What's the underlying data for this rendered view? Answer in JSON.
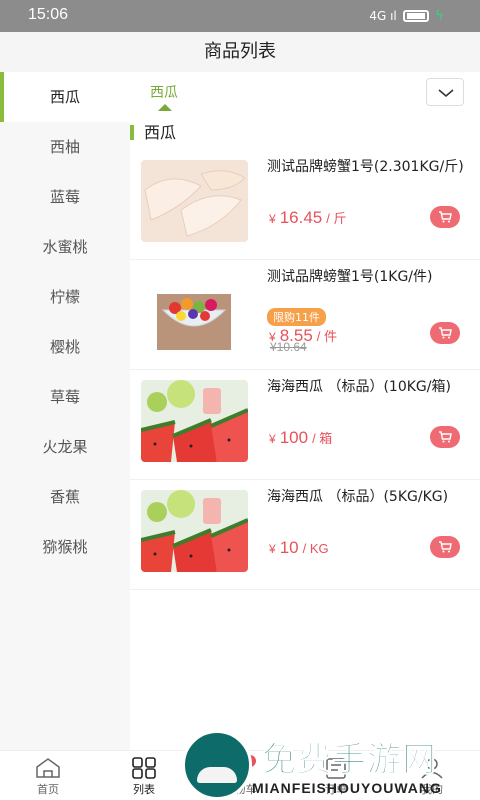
{
  "status": {
    "time": "15:06",
    "signal": "4G ıl"
  },
  "header": {
    "title": "商品列表"
  },
  "sidebar": {
    "items": [
      {
        "label": "西瓜"
      },
      {
        "label": "西柚"
      },
      {
        "label": "蓝莓"
      },
      {
        "label": "水蜜桃"
      },
      {
        "label": "柠檬"
      },
      {
        "label": "樱桃"
      },
      {
        "label": "草莓"
      },
      {
        "label": "火龙果"
      },
      {
        "label": "香蕉"
      },
      {
        "label": "猕猴桃"
      }
    ],
    "active": "西瓜"
  },
  "subtabs": {
    "active_label": "西瓜"
  },
  "section": {
    "title": "西瓜"
  },
  "products": [
    {
      "name": "测试品牌螃蟹1号(2.301KG/斤)",
      "currency": "¥",
      "price": "16.45",
      "unit": "/ 斤"
    },
    {
      "name": "测试品牌螃蟹1号(1KG/件)",
      "limit": "限购11件",
      "currency": "¥",
      "price": "8.55",
      "unit": "/ 件",
      "old_price": "¥10.64"
    },
    {
      "name": "海海西瓜 （标品）(10KG/箱)",
      "currency": "¥",
      "price": "100",
      "unit": "/ 箱"
    },
    {
      "name": "海海西瓜 （标品）(5KG/KG)",
      "currency": "¥",
      "price": "10",
      "unit": "/ KG"
    }
  ],
  "tabbar": {
    "items": [
      {
        "label": "首页"
      },
      {
        "label": "列表"
      },
      {
        "label": "购物车",
        "badge": "1"
      },
      {
        "label": "订单"
      },
      {
        "label": "我的"
      }
    ]
  },
  "watermark": {
    "title": "免费手游网",
    "subtitle": "MIANFEISHOUYOUWANG"
  },
  "colors": {
    "accent": "#8bbb3c",
    "price": "#e8525a",
    "badge": "#f6a04a"
  }
}
